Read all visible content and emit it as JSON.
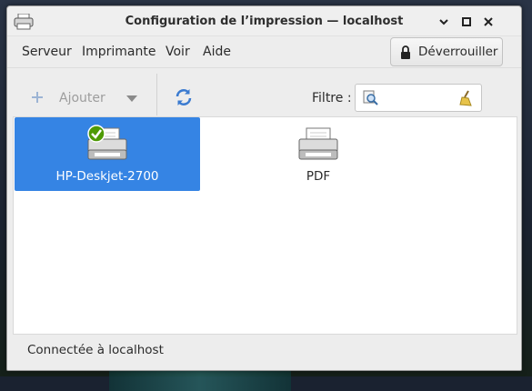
{
  "window": {
    "title": "Configuration de l’impression — localhost"
  },
  "menubar": {
    "items": [
      "Serveur",
      "Imprimante",
      "Voir",
      "Aide"
    ],
    "unlock_label": "Déverrouiller"
  },
  "toolbar": {
    "add_label": "Ajouter",
    "filter_label": "Filtre :",
    "filter_value": "",
    "filter_placeholder": ""
  },
  "printers": [
    {
      "name": "HP-Deskjet-2700",
      "selected": true,
      "default": true,
      "icon": "printer-icon"
    },
    {
      "name": "PDF",
      "selected": false,
      "default": false,
      "icon": "printer-icon"
    }
  ],
  "status": {
    "text": "Connectée à localhost"
  },
  "colors": {
    "selection": "#3584e4",
    "default_badge": "#4e9a06"
  }
}
